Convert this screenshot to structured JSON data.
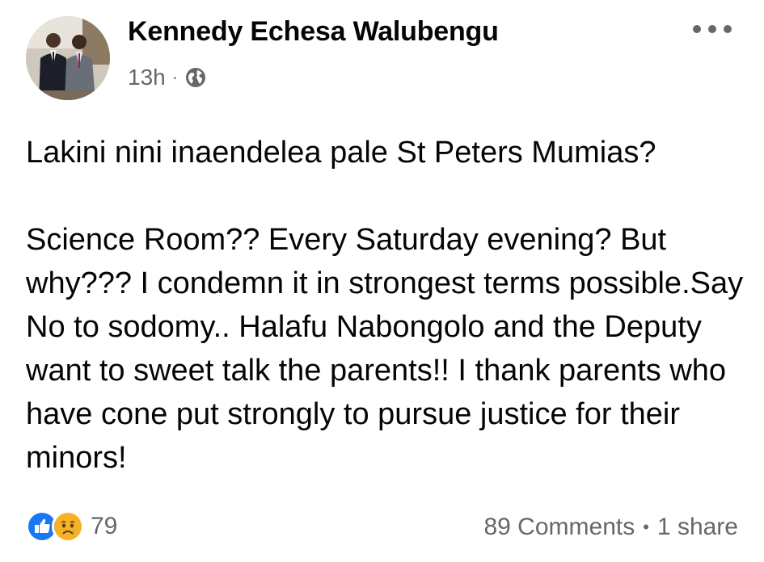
{
  "post": {
    "author": "Kennedy Echesa Walubengu",
    "time": "13h",
    "separator": "·",
    "privacy_icon": "globe-icon",
    "paragraphs": [
      "Lakini nini inaendelea pale St Peters Mumias?",
      "Science Room?? Every Saturday evening? But why??? I condemn it in strongest terms possible.Say  No to sodomy.. Halafu Nabongolo and the Deputy want to sweet talk the parents!! I thank parents who have cone put strongly to pursue justice for their minors!"
    ],
    "reactions": {
      "icons": [
        "like-icon",
        "sad-icon"
      ],
      "count": "79"
    },
    "comments": "89 Comments",
    "stats_separator": "•",
    "shares": "1 share"
  },
  "colors": {
    "text": "#050505",
    "secondary": "#65676b",
    "like_blue": "#1877f2",
    "sad_yellow": "#f7b125"
  }
}
